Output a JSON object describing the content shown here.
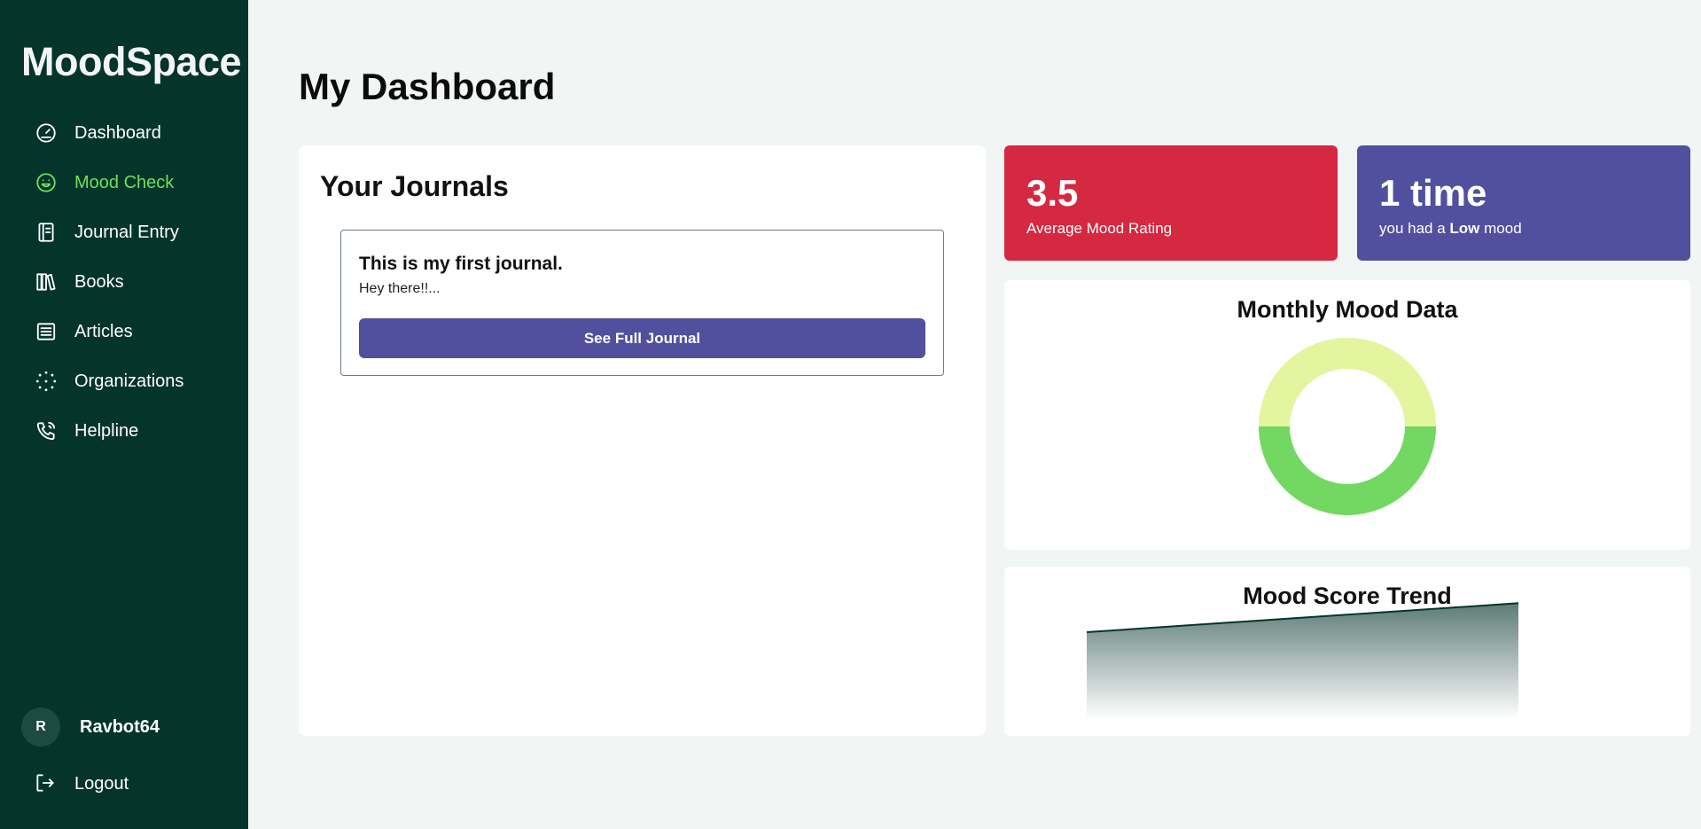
{
  "app": {
    "brand": "MoodSpace"
  },
  "sidebar": {
    "items": [
      {
        "label": "Dashboard",
        "icon": "gauge-icon",
        "active": false
      },
      {
        "label": "Mood Check",
        "icon": "smile-icon",
        "active": true
      },
      {
        "label": "Journal Entry",
        "icon": "journal-icon",
        "active": false
      },
      {
        "label": "Books",
        "icon": "books-icon",
        "active": false
      },
      {
        "label": "Articles",
        "icon": "article-icon",
        "active": false
      },
      {
        "label": "Organizations",
        "icon": "dots-icon",
        "active": false
      },
      {
        "label": "Helpline",
        "icon": "phone-icon",
        "active": false
      }
    ],
    "user": {
      "initial": "R",
      "name": "Ravbot64"
    },
    "logout_label": "Logout"
  },
  "main": {
    "title": "My Dashboard",
    "journals": {
      "heading": "Your Journals",
      "items": [
        {
          "title": "This is my first journal.",
          "preview": "Hey there!!...",
          "button_label": "See Full Journal"
        }
      ]
    },
    "stats": {
      "average": {
        "value": "3.5",
        "label": "Average Mood Rating"
      },
      "low": {
        "value": "1 time",
        "label_prefix": "you had a ",
        "label_bold": "Low",
        "label_suffix": " mood"
      }
    },
    "monthly": {
      "title": "Monthly Mood Data"
    },
    "trend": {
      "title": "Mood Score Trend"
    }
  },
  "colors": {
    "sidebar_bg": "#05342b",
    "active_nav": "#6ee05f",
    "accent_purple": "#50509e",
    "accent_red": "#d52841",
    "donut_light": "#e3f59f",
    "donut_green": "#72d862",
    "trend_line": "#05342b"
  },
  "chart_data": [
    {
      "type": "pie",
      "title": "Monthly Mood Data",
      "slices": [
        {
          "value": 50,
          "color": "#e3f59f"
        },
        {
          "value": 50,
          "color": "#72d862"
        }
      ]
    },
    {
      "type": "area",
      "title": "Mood Score Trend",
      "x": [
        0,
        1
      ],
      "values": [
        3,
        4
      ],
      "ylim": [
        0,
        5
      ]
    }
  ]
}
